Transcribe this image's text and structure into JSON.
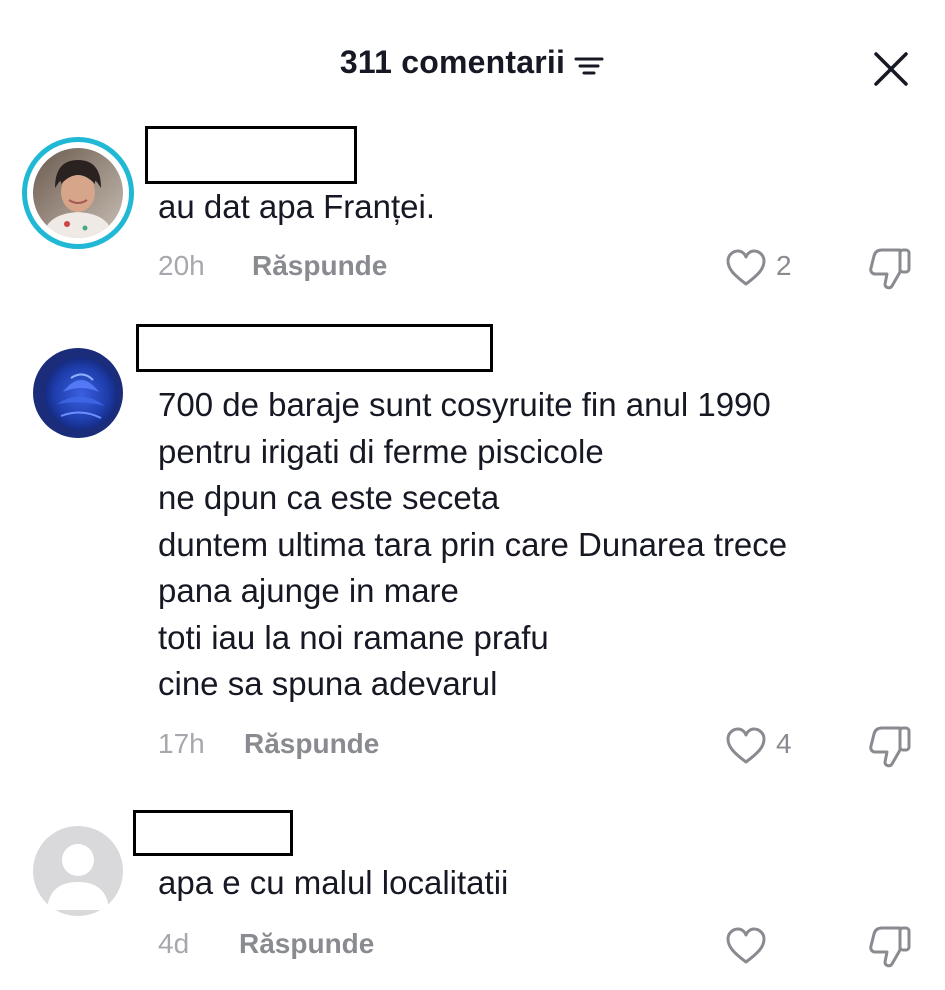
{
  "header": {
    "title": "311 comentarii"
  },
  "comments": [
    {
      "text_lines": [
        "au dat apa Franței."
      ],
      "time": "20h",
      "reply_label": "Răspunde",
      "likes": "2"
    },
    {
      "text_lines": [
        "700 de baraje sunt cosyruite fin anul 1990",
        "pentru irigati di ferme piscicole",
        "ne dpun ca este seceta",
        "duntem ultima tara prin care Dunarea trece",
        "pana ajunge in mare",
        "toti iau la noi ramane prafu",
        "cine sa spuna adevarul"
      ],
      "time": "17h",
      "reply_label": "Răspunde",
      "likes": "4"
    },
    {
      "text_lines": [
        "apa e cu malul localitatii"
      ],
      "time": "4d",
      "reply_label": "Răspunde",
      "likes": ""
    }
  ],
  "colors": {
    "accent_ring": "#21b8d6",
    "meta_gray": "#8a8b91",
    "text": "#161823"
  }
}
